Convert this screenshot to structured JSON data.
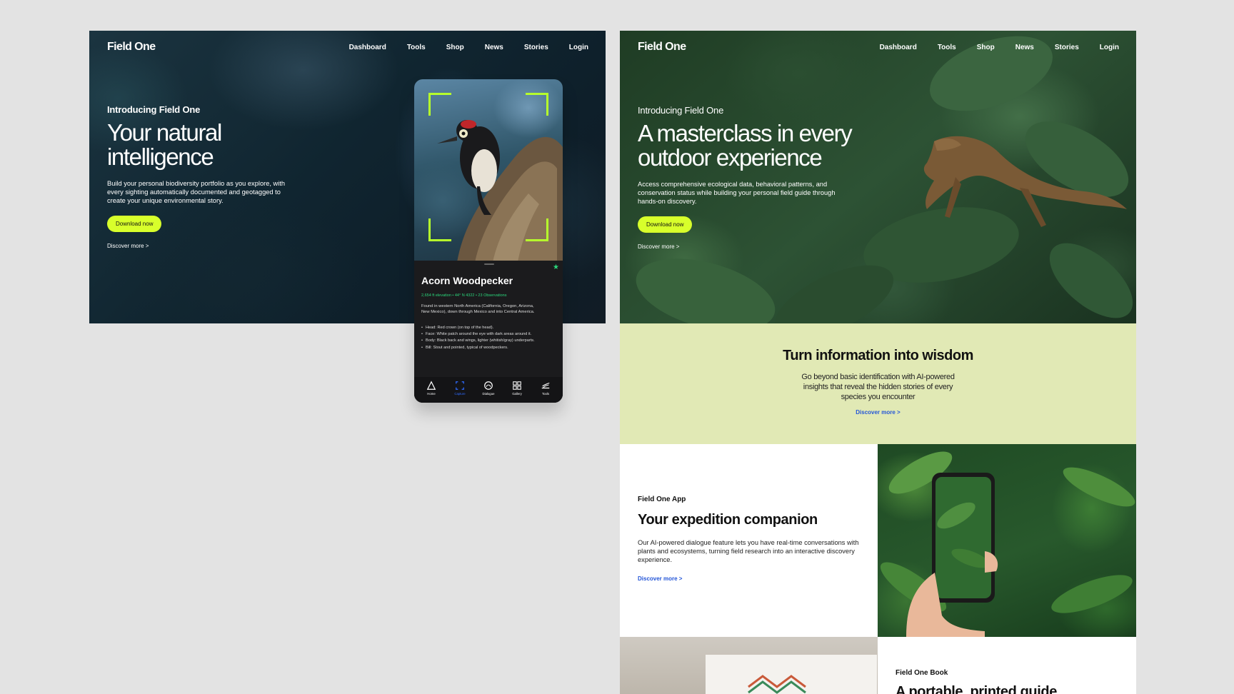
{
  "brand": "Field One",
  "nav": [
    "Dashboard",
    "Tools",
    "Shop",
    "News",
    "Stories",
    "Login"
  ],
  "left": {
    "eyebrow": "Introducing Field One",
    "title_line1": "Your natural",
    "title_line2": "intelligence",
    "body_line1": "Build your personal biodiversity portfolio as you explore, with",
    "body_line2": "every sighting automatically documented and geotagged to",
    "body_line3": "create your unique environmental story.",
    "cta": "Download now",
    "discover": "Discover more >"
  },
  "phone": {
    "species": "Acorn Woodpecker",
    "meta": "2,654 ft elevation  •  44° N 4322  •  23 Observations",
    "desc_line1": "Found in western North America (California, Oregon, Arizona,",
    "desc_line2": "New Mexico), down through Mexico and into Central America.",
    "traits": [
      "Head: Red crown (on top of the head).",
      "Face: White patch around the eye with dark areas around it.",
      "Body: Black back and wings, lighter (whitish/gray) underparts.",
      "Bill: Stout and pointed, typical of woodpeckers."
    ],
    "tabs": [
      "Home",
      "Capture",
      "Dialogue",
      "Gallery",
      "Tools"
    ]
  },
  "right": {
    "eyebrow": "Introducing Field One",
    "title_line1": "A masterclass in every",
    "title_line2": "outdoor experience",
    "body_line1": "Access comprehensive ecological data, behavioral patterns, and",
    "body_line2": "conservation status while building your personal field guide through",
    "body_line3": "hands-on discovery.",
    "cta": "Download now",
    "discover": "Discover more >",
    "wisdom": {
      "title": "Turn information into wisdom",
      "body": "Go beyond basic identification with AI-powered insights that reveal the hidden stories of every species you encounter",
      "link": "Discover more >"
    },
    "app": {
      "kicker": "Field One App",
      "title": "Your expedition companion",
      "body": "Our AI-powered dialogue feature lets you have real-time conversations with plants and ecosystems, turning field research into an interactive discovery experience.",
      "link": "Discover more >"
    },
    "book": {
      "kicker": "Field One Book",
      "title": "A portable, printed guide"
    }
  },
  "colors": {
    "accent": "#d8ff2b",
    "bracket": "#b6ff2c",
    "link": "#2456d8",
    "wisdom_bg": "#e1e9b5",
    "green_meta": "#2bd67b",
    "tab_active": "#2f6bff"
  },
  "icons": [
    "star-icon",
    "home-icon",
    "capture-icon",
    "dialogue-icon",
    "gallery-icon",
    "tools-icon"
  ]
}
